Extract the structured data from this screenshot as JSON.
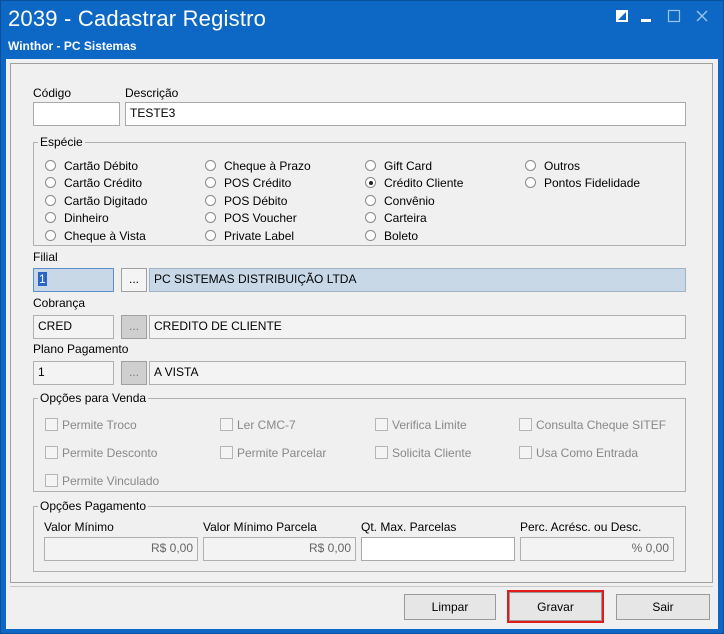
{
  "window": {
    "title": "2039 - Cadastrar Registro",
    "subtitle": "Winthor - PC Sistemas",
    "accent_color": "#0d68c5",
    "controls": [
      "restore-icon",
      "minimize-icon",
      "maximize-icon",
      "close-icon"
    ]
  },
  "form": {
    "codigo_label": "Código",
    "codigo_value": "",
    "descricao_label": "Descrição",
    "descricao_value": "TESTE3",
    "especie": {
      "title": "Espécie",
      "selected": "Crédito Cliente",
      "options": [
        "Cartão Débito",
        "Cartão Crédito",
        "Cartão Digitado",
        "Dinheiro",
        "Cheque à Vista",
        "Cheque à Prazo",
        "POS Crédito",
        "POS Débito",
        "POS Voucher",
        "Private Label",
        "Gift Card",
        "Crédito Cliente",
        "Convênio",
        "Carteira",
        "Boleto",
        "Outros",
        "Pontos Fidelidade"
      ]
    },
    "filial": {
      "label": "Filial",
      "code": "1",
      "button": "...",
      "name": "PC SISTEMAS DISTRIBUIÇÃO LTDA"
    },
    "cobranca": {
      "label": "Cobrança",
      "code": "CRED",
      "button": "...",
      "name": "CREDITO DE CLIENTE"
    },
    "plano": {
      "label": "Plano Pagamento",
      "code": "1",
      "button": "...",
      "name": "A VISTA"
    },
    "opcoes_venda": {
      "title": "Opções para Venda",
      "items": [
        "Permite Troco",
        "Ler CMC-7",
        "Verifica Limite",
        "Consulta Cheque SITEF",
        "Permite Desconto",
        "Permite Parcelar",
        "Solicita Cliente",
        "Usa Como Entrada",
        "Permite Vinculado"
      ]
    },
    "opcoes_pagamento": {
      "title": "Opções Pagamento",
      "fields": [
        {
          "label": "Valor Mínimo",
          "value": "R$ 0,00"
        },
        {
          "label": "Valor Mínimo Parcela",
          "value": "R$ 0,00"
        },
        {
          "label": "Qt. Max. Parcelas",
          "value": ""
        },
        {
          "label": "Perc. Acrésc. ou Desc.",
          "value": "% 0,00"
        }
      ]
    }
  },
  "buttons": {
    "limpar": "Limpar",
    "gravar": "Gravar",
    "sair": "Sair"
  }
}
